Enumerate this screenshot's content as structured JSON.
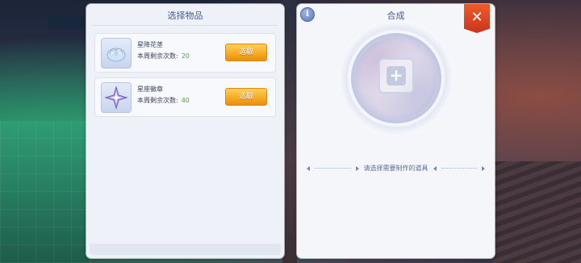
{
  "left_panel": {
    "title": "选择物品",
    "items": [
      {
        "name": "星降花茎",
        "remaining_label": "本周剩余次数:",
        "remaining": "20",
        "button": "选取",
        "icon": "flower-crystal-icon"
      },
      {
        "name": "星座徽章",
        "remaining_label": "本周剩余次数:",
        "remaining": "40",
        "button": "选取",
        "icon": "star-badge-icon"
      }
    ]
  },
  "right_panel": {
    "title": "合成",
    "info_label": "i",
    "close_label": "✕",
    "slot_label": "+",
    "hint": "请选择需要制作的道具"
  },
  "colors": {
    "accent_orange": "#f6a820",
    "count_green": "#4ca24c",
    "title_blue": "#4a5d8a",
    "close_red": "#e04a24"
  }
}
